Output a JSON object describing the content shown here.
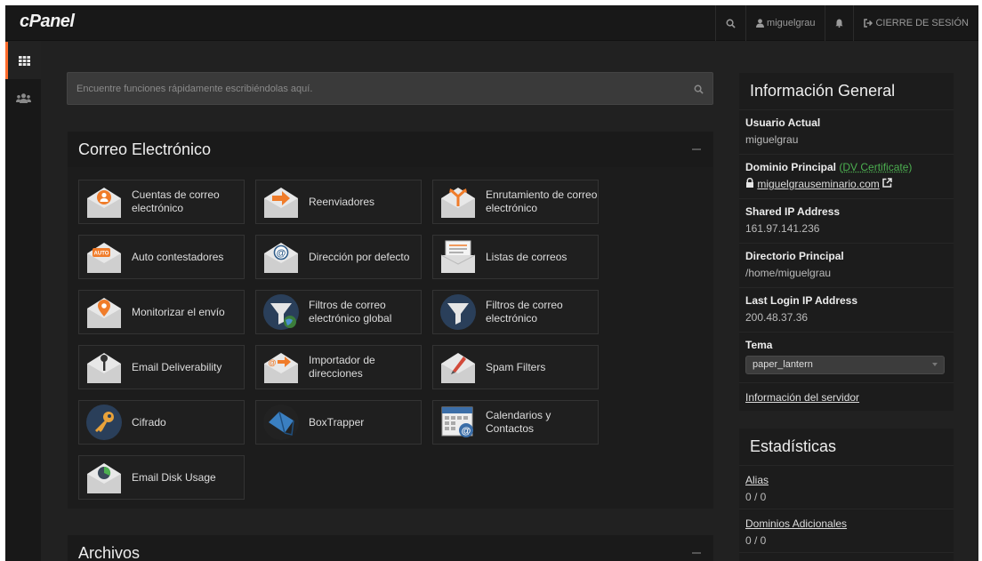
{
  "topbar": {
    "logo": "cPanel",
    "user": "miguelgrau",
    "logout": "CIERRE DE SESIÓN"
  },
  "rail": [
    {
      "icon": "grid-icon",
      "active": true
    },
    {
      "icon": "users-icon",
      "active": false
    }
  ],
  "search": {
    "placeholder": "Encuentre funciones rápidamente escribiéndolas aquí."
  },
  "email_panel": {
    "title": "Correo Electrónico",
    "tiles": [
      {
        "label": "Cuentas de correo electrónico",
        "icon": "email-accounts-icon"
      },
      {
        "label": "Reenviadores",
        "icon": "forwarders-icon"
      },
      {
        "label": "Enrutamiento de correo electrónico",
        "icon": "email-routing-icon"
      },
      {
        "label": "Auto contestadores",
        "icon": "autoresponder-icon"
      },
      {
        "label": "Dirección por defecto",
        "icon": "default-address-icon"
      },
      {
        "label": "Listas de correos",
        "icon": "mailing-lists-icon"
      },
      {
        "label": "Monitorizar el envío",
        "icon": "track-delivery-icon"
      },
      {
        "label": "Filtros de correo electrónico global",
        "icon": "global-filters-icon"
      },
      {
        "label": "Filtros de correo electrónico",
        "icon": "email-filters-icon"
      },
      {
        "label": "Email Deliverability",
        "icon": "deliverability-icon"
      },
      {
        "label": "Importador de direcciones",
        "icon": "address-importer-icon"
      },
      {
        "label": "Spam Filters",
        "icon": "spam-filters-icon"
      },
      {
        "label": "Cifrado",
        "icon": "encryption-key-icon"
      },
      {
        "label": "BoxTrapper",
        "icon": "boxtrapper-icon"
      },
      {
        "label": "Calendarios y Contactos",
        "icon": "calendar-icon"
      },
      {
        "label": "Email Disk Usage",
        "icon": "disk-usage-icon"
      }
    ]
  },
  "files_panel": {
    "title": "Archivos"
  },
  "info": {
    "title": "Información General",
    "current_user_label": "Usuario Actual",
    "current_user": "miguelgrau",
    "domain_label": "Dominio Principal",
    "dv_cert": "DV Certificate",
    "domain": "miguelgrauseminario.com",
    "ip_label": "Shared IP Address",
    "ip": "161.97.141.236",
    "home_label": "Directorio Principal",
    "home": "/home/miguelgrau",
    "last_login_label": "Last Login IP Address",
    "last_login": "200.48.37.36",
    "theme_label": "Tema",
    "theme": "paper_lantern",
    "server_info": "Información del servidor"
  },
  "stats": {
    "title": "Estadísticas",
    "items": [
      {
        "label": "Alias",
        "value": "0 / 0"
      },
      {
        "label": "Dominios Adicionales",
        "value": "0 / 0"
      }
    ]
  }
}
